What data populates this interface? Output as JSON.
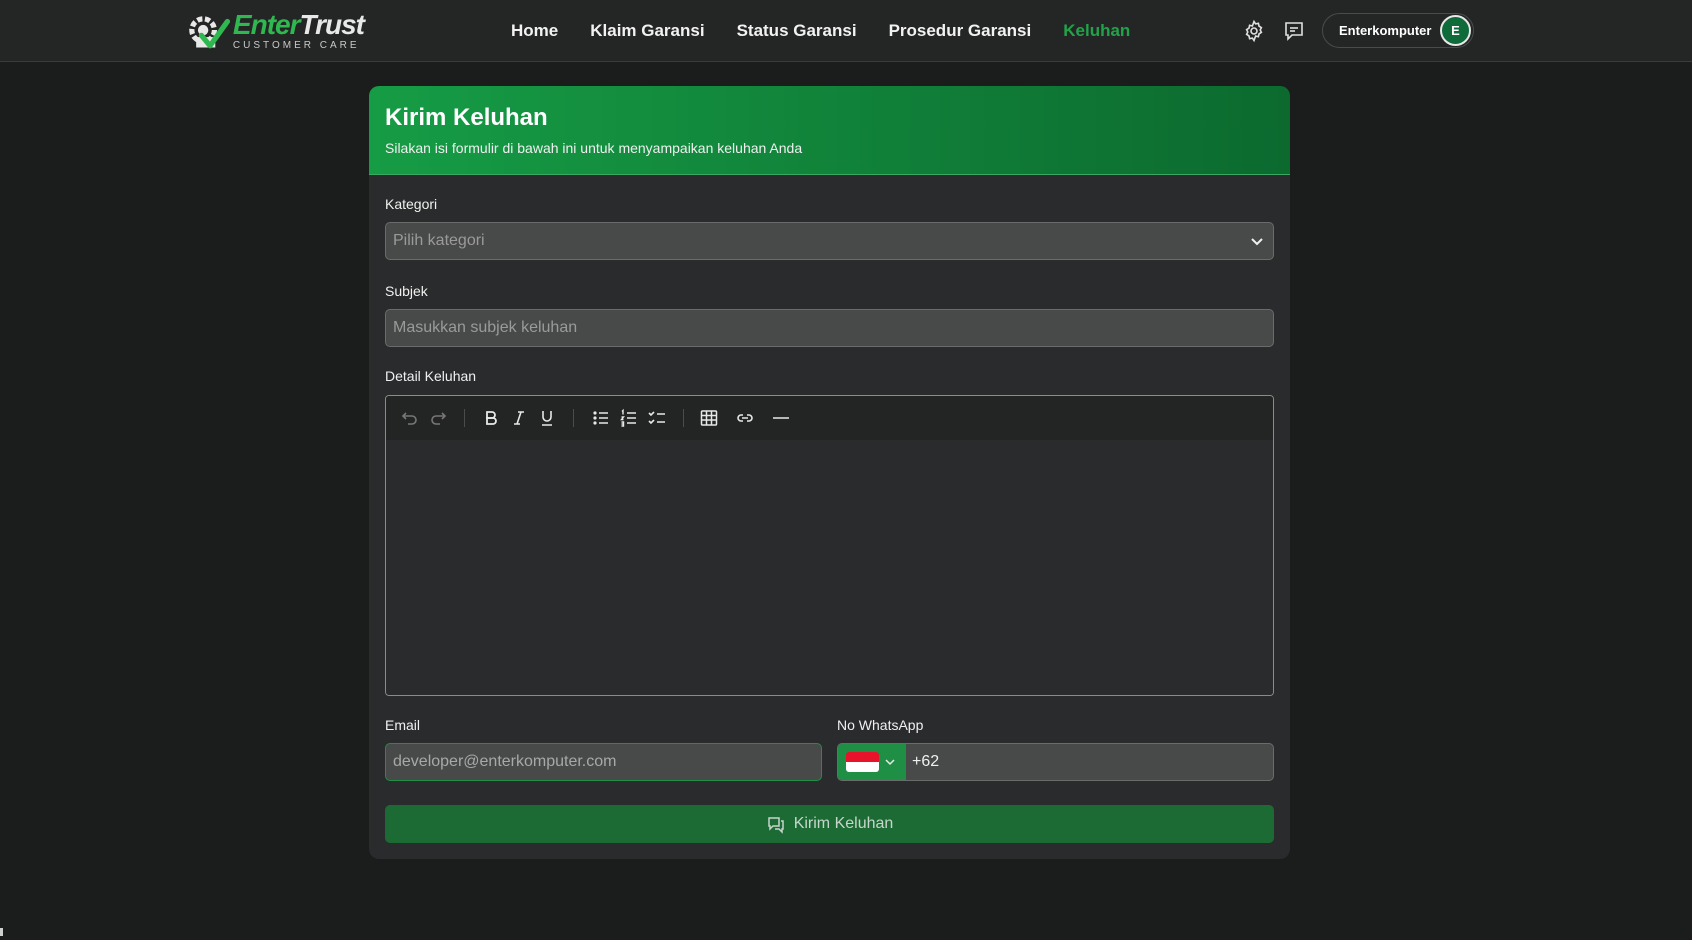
{
  "brand": {
    "name_green": "Enter",
    "name_white": "Trust",
    "tagline": "CUSTOMER CARE",
    "accent": "#22a24a"
  },
  "nav": {
    "links": [
      {
        "label": "Home"
      },
      {
        "label": "Klaim Garansi"
      },
      {
        "label": "Status Garansi"
      },
      {
        "label": "Prosedur Garansi"
      },
      {
        "label": "Keluhan"
      }
    ],
    "active": "Keluhan",
    "icons": [
      "gear-icon",
      "chat-icon"
    ],
    "user": {
      "name": "Enterkomputer",
      "initial": "E"
    }
  },
  "form": {
    "title": "Kirim Keluhan",
    "subtitle": "Silakan isi formulir di bawah ini untuk menyampaikan keluhan Anda",
    "category": {
      "label": "Kategori",
      "placeholder": "Pilih kategori"
    },
    "subject": {
      "label": "Subjek",
      "placeholder": "Masukkan subjek keluhan"
    },
    "detail": {
      "label": "Detail Keluhan",
      "toolbar": [
        "undo-icon",
        "redo-icon",
        "bold-icon",
        "italic-icon",
        "underline-icon",
        "bullet-list-icon",
        "numbered-list-icon",
        "checklist-icon",
        "table-icon",
        "link-icon",
        "horizontal-rule-icon"
      ]
    },
    "email": {
      "label": "Email",
      "value": "developer@enterkomputer.com"
    },
    "whatsapp": {
      "label": "No WhatsApp",
      "country": "ID",
      "value": "+62"
    },
    "submit_label": "Kirim Keluhan"
  }
}
